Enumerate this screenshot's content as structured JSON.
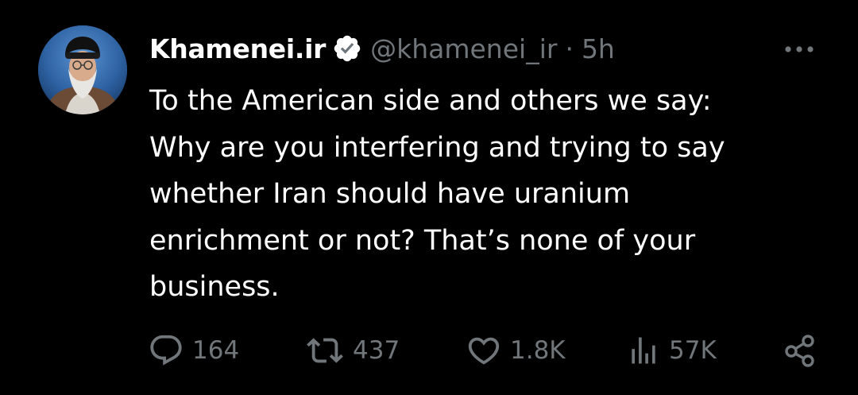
{
  "tweet": {
    "display_name": "Khamenei.ir",
    "handle": "@khamenei_ir",
    "separator": "·",
    "time": "5h",
    "text": "To the American side and others we say:\nWhy are you interfering and trying to say\nwhether Iran should have uranium\nenrichment or not? That’s none of your\nbusiness.",
    "avatar_icon": "avatar-portrait",
    "verified_icon": "verified-badge-icon",
    "more_icon": "more-options-icon"
  },
  "actions": {
    "reply": {
      "icon": "reply-icon",
      "count": "164"
    },
    "retweet": {
      "icon": "retweet-icon",
      "count": "437"
    },
    "like": {
      "icon": "heart-icon",
      "count": "1.8K"
    },
    "views": {
      "icon": "views-icon",
      "count": "57K"
    },
    "share": {
      "icon": "share-icon"
    }
  },
  "colors": {
    "background": "#000000",
    "primary_text": "#ffffff",
    "secondary_text": "#71767b"
  }
}
